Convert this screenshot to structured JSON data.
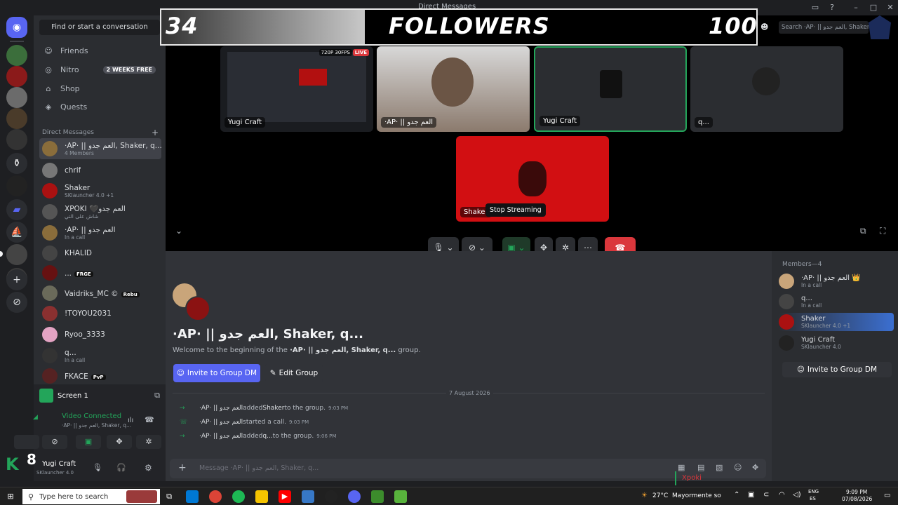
{
  "window": {
    "title": "Direct Messages"
  },
  "overlay": {
    "left_count": "34",
    "label": "FOLLOWERS",
    "right_count": "100"
  },
  "header": {
    "search_text": "Search ·AP· || العم جدو, Shaker,"
  },
  "sidebar": {
    "search_placeholder": "Find or start a conversation",
    "nav": [
      {
        "label": "Friends",
        "icon": "friends-icon"
      },
      {
        "label": "Nitro",
        "icon": "nitro-icon",
        "badge": "2 WEEKS FREE"
      },
      {
        "label": "Shop",
        "icon": "shop-icon"
      },
      {
        "label": "Quests",
        "icon": "quests-icon"
      }
    ],
    "dm_header": "Direct Messages",
    "dms": [
      {
        "name": "·AP· || العم جدو, Shaker, q...",
        "sub": "4 Members",
        "selected": true
      },
      {
        "name": "chrif",
        "sub": ""
      },
      {
        "name": "Shaker",
        "sub": "SKlauncher 4.0 +1"
      },
      {
        "name": "XPOKI 🖤العم جدو",
        "sub": "شاش على التي"
      },
      {
        "name": "·AP· || العم جدو",
        "sub": "In a call"
      },
      {
        "name": "KHALID",
        "sub": ""
      },
      {
        "name": "...",
        "sub": "",
        "tag": "FRGE"
      },
      {
        "name": "Vaidriks_MC ©",
        "sub": "",
        "tag": "Rebu"
      },
      {
        "name": "!TOYOU2031",
        "sub": ""
      },
      {
        "name": "Ryoo_3333",
        "sub": ""
      },
      {
        "name": "q...",
        "sub": "In a call"
      },
      {
        "name": "FKACE",
        "sub": "",
        "tag": "PvP"
      }
    ]
  },
  "voice_panel": {
    "stream_label": "Screen 1",
    "status": "Video Connected",
    "channel": "·AP· || العم جدو, Shaker, q...",
    "user_name": "Yugi Craft",
    "user_sub": "SKlauncher 4.0",
    "overlay_digit": "8"
  },
  "stage": {
    "tiles": [
      {
        "label": "Yugi Craft",
        "badge_quality": "720P 30FPS",
        "badge_live": "LIVE"
      },
      {
        "label": "·AP· || العم جدو"
      },
      {
        "label": "Yugi Craft"
      },
      {
        "label": "q..."
      },
      {
        "label": "Shaker"
      }
    ],
    "tooltip": "Stop Streaming"
  },
  "chat": {
    "group_title": "·AP· || العم جدو, Shaker, q...",
    "welcome_prefix": "Welcome to the beginning of the ",
    "welcome_group": "·AP· || العم جدو, Shaker, q...",
    "welcome_suffix": " group.",
    "invite_button": "Invite to Group DM",
    "edit_button": "Edit Group",
    "date_divider": "7 August 2026",
    "events": [
      {
        "actor": "·AP· || العم جدو",
        "action": " added ",
        "target": "Shaker",
        "rest": " to the group.",
        "time": "9:03 PM"
      },
      {
        "actor": "·AP· || العم جدو",
        "action": " started a call.",
        "target": "",
        "rest": "",
        "time": "9:03 PM"
      },
      {
        "actor": "·AP· || العم جدو",
        "action": " added ",
        "target": "q...",
        "rest": " to the group.",
        "time": "9:06 PM"
      }
    ],
    "composer_placeholder": "Message ·AP· || العم جدو, Shaker, q..."
  },
  "members": {
    "header": "Members—4",
    "list": [
      {
        "name": "·AP· || العم جدو 👑",
        "sub": "In a call"
      },
      {
        "name": "q...",
        "sub": "In a call"
      },
      {
        "name": "Shaker",
        "sub": "SKlauncher 4.0 +1"
      },
      {
        "name": "Yugi Craft",
        "sub": "SKlauncher 4.0"
      }
    ],
    "invite_button": "Invite to Group DM"
  },
  "taskbar": {
    "search_placeholder": "Type here to search",
    "weather": "27°C",
    "weather_text": "Mayormente soleado",
    "lang_top": "ENG",
    "lang_bottom": "ES",
    "time": "9:09 PM",
    "date": "07/08/2026",
    "overlay_name": "Xpoki"
  },
  "colors": {
    "accent": "#5865f2",
    "danger": "#da373c",
    "online": "#23a55a",
    "bg": "#1e1f22"
  }
}
